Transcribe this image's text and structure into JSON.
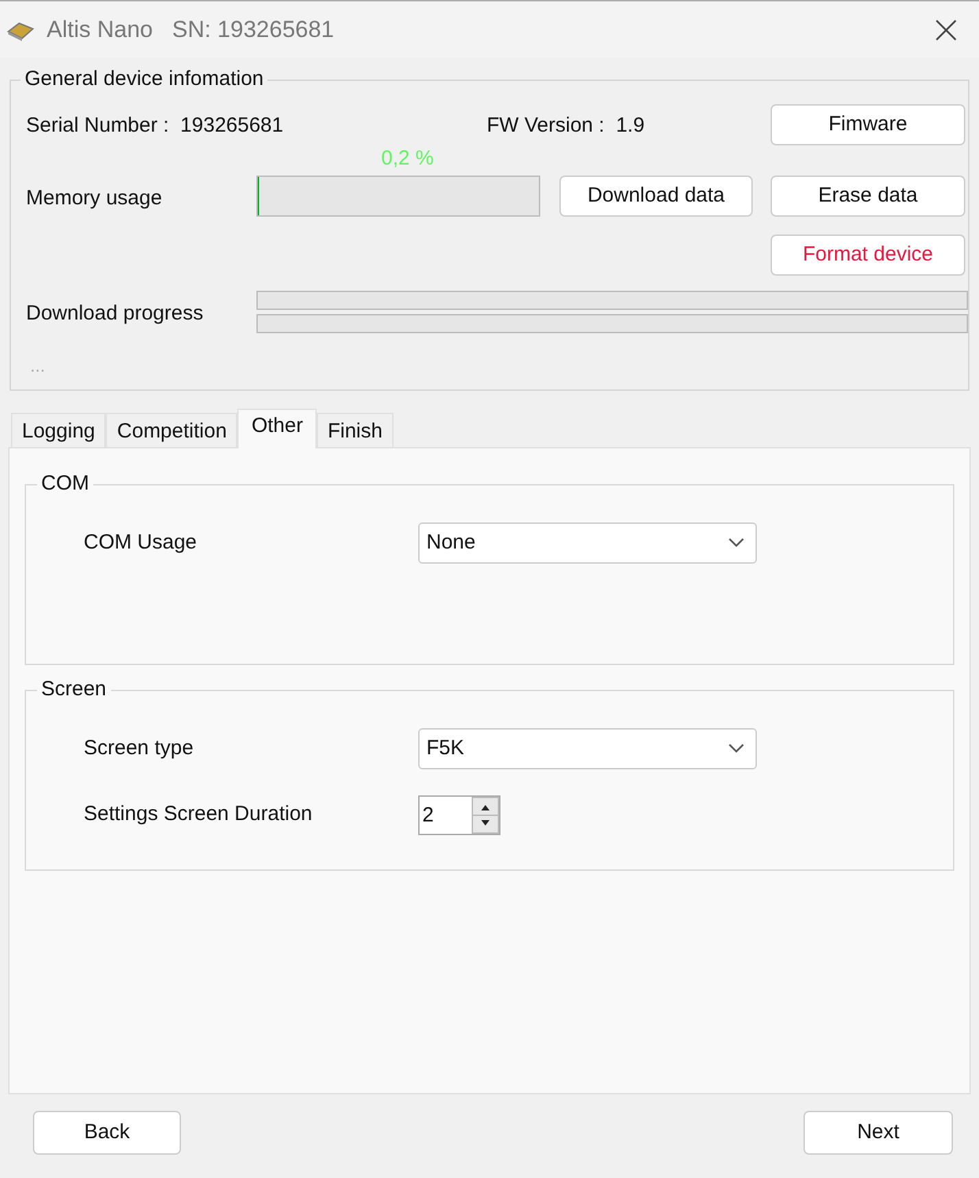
{
  "window": {
    "title": "Altis Nano",
    "serial_label": "SN: 193265681"
  },
  "device_info": {
    "title": "General device infomation",
    "serial_number": "Serial Number :  193265681",
    "fw_version": "FW Version :  1.9",
    "memory_label": "Memory usage",
    "memory_percent": "0,2 %",
    "memory_bar": {
      "level": 0.002
    },
    "download_label": "Download progress",
    "download_bars": [
      {
        "level": 0
      },
      {
        "level": 0
      }
    ],
    "status": "...",
    "buttons": [
      {
        "label": "Fimware",
        "kind": "normal"
      },
      {
        "label": "Download data",
        "kind": "normal"
      },
      {
        "label": "Erase data",
        "kind": "normal"
      },
      {
        "label": "Format device",
        "kind": "danger"
      }
    ]
  },
  "tabs": [
    {
      "label": "Logging",
      "selected": false
    },
    {
      "label": "Competition",
      "selected": false
    },
    {
      "label": "Other",
      "selected": true
    },
    {
      "label": "Finish",
      "selected": false
    }
  ],
  "groups": [
    {
      "title": "COM",
      "fields": [
        {
          "label": "COM Usage",
          "kind": "dropdown",
          "value": "None"
        }
      ]
    },
    {
      "title": "Screen",
      "fields": [
        {
          "label": "Screen type",
          "kind": "dropdown",
          "value": "F5K"
        },
        {
          "label": "Settings Screen Duration",
          "kind": "spinner",
          "value": "2"
        }
      ]
    }
  ],
  "footer": {
    "back": "Back",
    "next": "Next"
  }
}
